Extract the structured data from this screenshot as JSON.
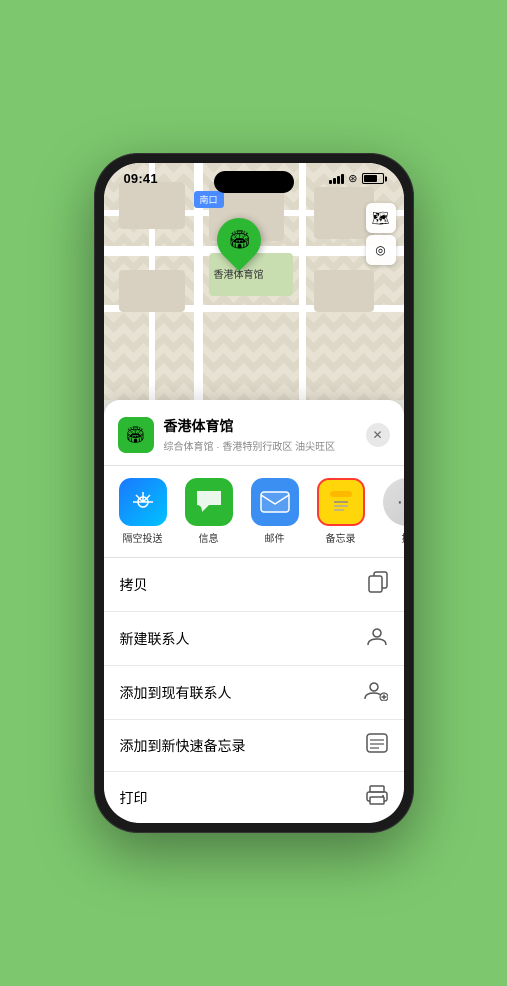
{
  "status_bar": {
    "time": "09:41",
    "location_arrow": "▲"
  },
  "map": {
    "location_label": "南口",
    "map_icon": "🗺",
    "compass_icon": "◎",
    "pin_label": "香港体育馆",
    "pin_emoji": "🏟"
  },
  "bottom_sheet": {
    "venue_logo_emoji": "🏟",
    "venue_name": "香港体育馆",
    "venue_sub": "综合体育馆 · 香港特别行政区 油尖旺区",
    "close_label": "✕"
  },
  "share_items": [
    {
      "id": "airdrop",
      "label": "隔空投送",
      "emoji": "📡"
    },
    {
      "id": "messages",
      "label": "信息",
      "emoji": "💬"
    },
    {
      "id": "mail",
      "label": "邮件",
      "emoji": "✉️"
    },
    {
      "id": "notes",
      "label": "备忘录",
      "emoji": "📝"
    },
    {
      "id": "more",
      "label": "提",
      "emoji": "⋯"
    }
  ],
  "action_items": [
    {
      "label": "拷贝",
      "icon": "⎘"
    },
    {
      "label": "新建联系人",
      "icon": "👤"
    },
    {
      "label": "添加到现有联系人",
      "icon": "👤"
    },
    {
      "label": "添加到新快速备忘录",
      "icon": "⊞"
    },
    {
      "label": "打印",
      "icon": "🖨"
    }
  ],
  "colors": {
    "green": "#2db833",
    "blue": "#3b8ff3",
    "red_border": "#ff3b30",
    "notes_yellow": "#FFD60A"
  }
}
